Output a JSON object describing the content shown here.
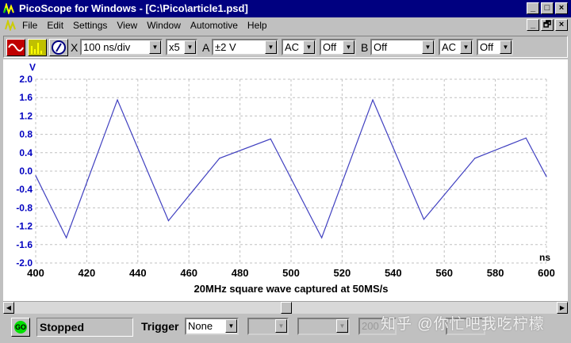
{
  "window": {
    "title": "PicoScope for Windows - [C:\\Pico\\article1.psd]",
    "min": "_",
    "max": "□",
    "close": "×",
    "restore": "🗗"
  },
  "menu": [
    "File",
    "Edit",
    "Settings",
    "View",
    "Window",
    "Automotive",
    "Help"
  ],
  "toolbar": {
    "x_label": "X",
    "timebase": "100 ns/div",
    "multiplier": "x5",
    "a_label": "A",
    "a_range": "±2 V",
    "a_coupling": "AC",
    "a_offset": "Off",
    "b_label": "B",
    "b_range": "Off",
    "b_coupling": "AC",
    "b_offset": "Off",
    "arrow": "▼"
  },
  "status": {
    "go": "GO",
    "state": "Stopped",
    "trigger_label": "Trigger",
    "trigger": "None",
    "trigger_level": "200"
  },
  "watermark": "知乎 @你忙吧我吃柠檬",
  "colors": {
    "trace": "#4040c0",
    "axis_text": "#0000c0",
    "title_bar": "#000080"
  },
  "chart_data": {
    "type": "line",
    "title": "20MHz square wave captured at 50MS/s",
    "ylabel": "V",
    "xlabel": "ns",
    "xlim": [
      400,
      600
    ],
    "ylim": [
      -2.0,
      2.0
    ],
    "xticks": [
      "400",
      "420",
      "440",
      "460",
      "480",
      "500",
      "520",
      "540",
      "560",
      "580",
      "600"
    ],
    "yticks": [
      "2.0",
      "1.6",
      "1.2",
      "0.8",
      "0.4",
      "0.0",
      "-0.4",
      "-0.8",
      "-1.2",
      "-1.6",
      "-2.0"
    ],
    "grid": true,
    "series": [
      {
        "name": "A",
        "x": [
          400,
          412,
          432,
          452,
          472,
          492,
          512,
          532,
          552,
          572,
          592,
          600
        ],
        "y": [
          -0.1,
          -1.45,
          1.55,
          -1.08,
          0.28,
          0.7,
          -1.45,
          1.55,
          -1.05,
          0.28,
          0.72,
          -0.12
        ]
      }
    ]
  }
}
